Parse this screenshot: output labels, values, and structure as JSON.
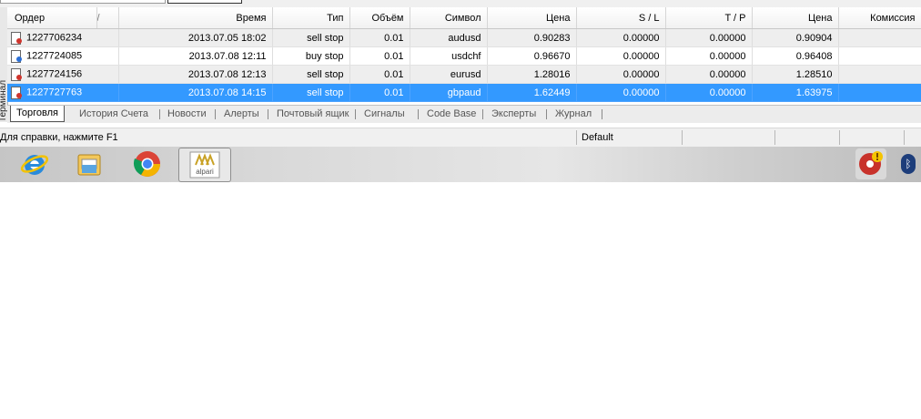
{
  "terminal_side_label": "Терминал",
  "columns": {
    "order": "Ордер",
    "sort_indicator": "/",
    "time": "Время",
    "type": "Тип",
    "volume": "Объём",
    "symbol": "Символ",
    "price": "Цена",
    "sl": "S / L",
    "tp": "T / P",
    "cur_price": "Цена",
    "commission": "Комиссия"
  },
  "orders": [
    {
      "order": "1227706234",
      "time": "2013.07.05 18:02",
      "type": "sell stop",
      "volume": "0.01",
      "symbol": "audusd",
      "price": "0.90283",
      "sl": "0.00000",
      "tp": "0.00000",
      "cur_price": "0.90904",
      "commission": "",
      "icon_color": "#d0342c"
    },
    {
      "order": "1227724085",
      "time": "2013.07.08 12:11",
      "type": "buy stop",
      "volume": "0.01",
      "symbol": "usdchf",
      "price": "0.96670",
      "sl": "0.00000",
      "tp": "0.00000",
      "cur_price": "0.96408",
      "commission": "",
      "icon_color": "#2a6fd6"
    },
    {
      "order": "1227724156",
      "time": "2013.07.08 12:13",
      "type": "sell stop",
      "volume": "0.01",
      "symbol": "eurusd",
      "price": "1.28016",
      "sl": "0.00000",
      "tp": "0.00000",
      "cur_price": "1.28510",
      "commission": "",
      "icon_color": "#d0342c"
    },
    {
      "order": "1227727763",
      "time": "2013.07.08 14:15",
      "type": "sell stop",
      "volume": "0.01",
      "symbol": "gbpaud",
      "price": "1.62449",
      "sl": "0.00000",
      "tp": "0.00000",
      "cur_price": "1.63975",
      "commission": "",
      "icon_color": "#d0342c",
      "selected": true
    }
  ],
  "tabs": [
    "Торговля",
    "История Счета",
    "Новости",
    "Алерты",
    "Почтовый ящик",
    "Сигналы",
    "Code Base",
    "Эксперты",
    "Журнал"
  ],
  "status": {
    "help": "Для справки, нажмите F1",
    "profile": "Default"
  },
  "taskbar": {
    "apps": [
      "internet-explorer",
      "file-explorer",
      "chrome",
      "alpari"
    ],
    "alpari_label": "alpari"
  },
  "colors": {
    "selection": "#3399ff",
    "sell_icon": "#d0342c",
    "buy_icon": "#2a6fd6"
  }
}
